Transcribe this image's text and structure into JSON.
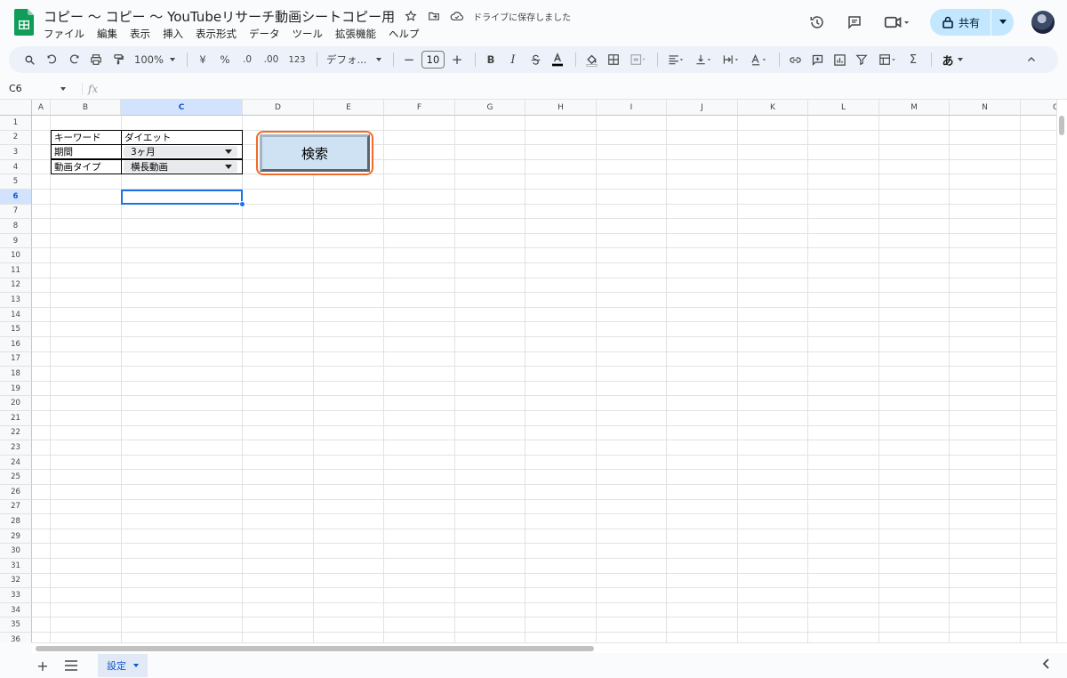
{
  "app": {
    "title": "コピー 〜 コピー 〜 YouTubeリサーチ動画シートコピー用",
    "save_status": "ドライブに保存しました",
    "share_label": "共有"
  },
  "menu": [
    "ファイル",
    "編集",
    "表示",
    "挿入",
    "表示形式",
    "データ",
    "ツール",
    "拡張機能",
    "ヘルプ"
  ],
  "toolbar": {
    "zoom": "100%",
    "currency": "¥",
    "percent": "%",
    "dec_decrease": ".0",
    "dec_increase": ".00",
    "number_format": "123",
    "font": "デフォ...",
    "font_size": "10",
    "bold": "B",
    "italic": "I",
    "sum": "Σ",
    "ime": "あ"
  },
  "formula_bar": {
    "name_box": "C6",
    "fx": "fx"
  },
  "columns": [
    "A",
    "B",
    "C",
    "D",
    "E",
    "F",
    "G",
    "H",
    "I",
    "J",
    "K",
    "L",
    "M",
    "N",
    "O"
  ],
  "rows": [
    "1",
    "2",
    "3",
    "4",
    "5",
    "6",
    "7",
    "8",
    "9",
    "10",
    "11",
    "12",
    "13",
    "14",
    "15",
    "16",
    "17",
    "18",
    "19",
    "20",
    "21",
    "22",
    "23",
    "24",
    "25",
    "26",
    "27",
    "28",
    "29",
    "30",
    "31",
    "32",
    "33",
    "34",
    "35",
    "36"
  ],
  "selected_cell": "C6",
  "cells": {
    "b2": "キーワード",
    "c2": "ダイエット",
    "b3": "期間",
    "c3": "3ヶ月",
    "b4": "動画タイプ",
    "c4": "横長動画"
  },
  "search_button": "検索",
  "sheet_tabs": [
    {
      "label": "設定",
      "active": true
    }
  ],
  "colors": {
    "accent": "#0b57d0",
    "selection_border": "#1a73e8",
    "button_fill": "#cfe2f3",
    "button_outline": "#f26b2a",
    "share_bg": "#c2e7ff"
  }
}
